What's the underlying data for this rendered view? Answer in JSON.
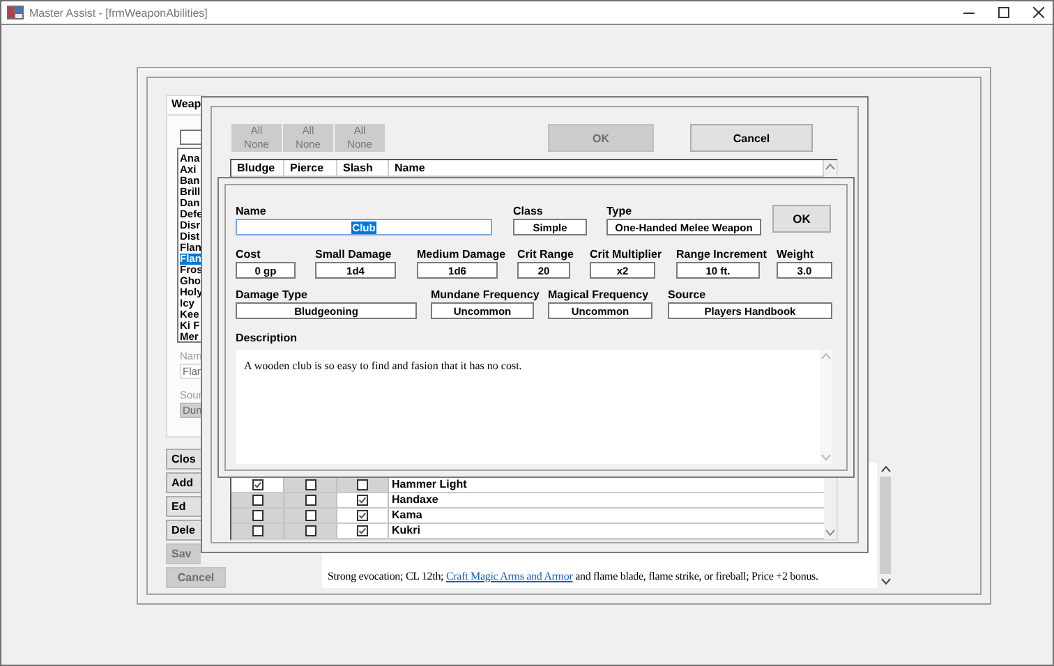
{
  "window": {
    "title": "Master Assist - [frmWeaponAbilities]"
  },
  "back_form": {
    "group_tab": "Weap",
    "list_items": [
      {
        "label": "Ana",
        "selected": false
      },
      {
        "label": "Axi",
        "selected": false
      },
      {
        "label": "Ban",
        "selected": false
      },
      {
        "label": "Brill",
        "selected": false
      },
      {
        "label": "Dan",
        "selected": false
      },
      {
        "label": "Defe",
        "selected": false
      },
      {
        "label": "Disr",
        "selected": false
      },
      {
        "label": "Dist",
        "selected": false
      },
      {
        "label": "Flan",
        "selected": false
      },
      {
        "label": "Flan",
        "selected": true
      },
      {
        "label": "Fros",
        "selected": false
      },
      {
        "label": "Gho",
        "selected": false
      },
      {
        "label": "Holy",
        "selected": false
      },
      {
        "label": "Icy",
        "selected": false
      },
      {
        "label": "Kee",
        "selected": false
      },
      {
        "label": "Ki F",
        "selected": false
      },
      {
        "label": "Mer",
        "selected": false
      }
    ],
    "name_label": "Nam",
    "name_value": "Flan",
    "source_label": "Sour",
    "source_value": "Dun",
    "buttons": [
      {
        "label": "Clos",
        "disabled": false
      },
      {
        "label": "Add",
        "disabled": false
      },
      {
        "label": "Ed",
        "disabled": false
      },
      {
        "label": "Dele",
        "disabled": false
      },
      {
        "label": "Sav",
        "disabled": true
      },
      {
        "label": "Cancel",
        "disabled": true
      }
    ],
    "description": {
      "before": "Strong evocation; CL 12th; ",
      "link": "Craft Magic Arms and Armor",
      "after": " and flame blade, flame strike, or fireball; Price +2 bonus."
    }
  },
  "weapon_picker": {
    "filter_buttons": [
      {
        "all": "All",
        "none": "None",
        "disabled": true
      },
      {
        "all": "All",
        "none": "None",
        "disabled": true
      },
      {
        "all": "All",
        "none": "None",
        "disabled": true
      }
    ],
    "ok_button": {
      "label": "OK",
      "disabled": true
    },
    "cancel_button": {
      "label": "Cancel",
      "disabled": false
    },
    "columns": [
      "Bludge",
      "Pierce",
      "Slash",
      "Name"
    ],
    "rows": [
      {
        "bludge": true,
        "pierce": false,
        "slash": false,
        "name": "Hammer Light"
      },
      {
        "bludge": false,
        "pierce": false,
        "slash": true,
        "name": "Handaxe"
      },
      {
        "bludge": false,
        "pierce": false,
        "slash": true,
        "name": "Kama"
      },
      {
        "bludge": false,
        "pierce": false,
        "slash": true,
        "name": "Kukri"
      }
    ]
  },
  "weapon_form": {
    "field_rows": [
      [
        {
          "label": "Name",
          "value": "Club",
          "highlighted": true
        },
        {
          "label": "Class",
          "value": "Simple",
          "highlighted": false
        },
        {
          "label": "Type",
          "value": "One-Handed Melee Weapon",
          "highlighted": false
        }
      ],
      [
        {
          "label": "Cost",
          "value": "0 gp",
          "highlighted": false
        },
        {
          "label": "Small Damage",
          "value": "1d4",
          "highlighted": false
        },
        {
          "label": "Medium Damage",
          "value": "1d6",
          "highlighted": false
        },
        {
          "label": "Crit Range",
          "value": "20",
          "highlighted": false
        },
        {
          "label": "Crit Multiplier",
          "value": "x2",
          "highlighted": false
        },
        {
          "label": "Range Increment",
          "value": "10 ft.",
          "highlighted": false
        },
        {
          "label": "Weight",
          "value": "3.0",
          "highlighted": false
        }
      ],
      [
        {
          "label": "Damage Type",
          "value": "Bludgeoning",
          "highlighted": false
        },
        {
          "label": "Mundane Frequency",
          "value": "Uncommon",
          "highlighted": false
        },
        {
          "label": "Magical Frequency",
          "value": "Uncommon",
          "highlighted": false
        },
        {
          "label": "Source",
          "value": "Players Handbook",
          "highlighted": false
        }
      ]
    ],
    "ok_button": "OK",
    "description_label": "Description",
    "description": "A wooden club is so easy to find and fasion that it has no cost."
  }
}
